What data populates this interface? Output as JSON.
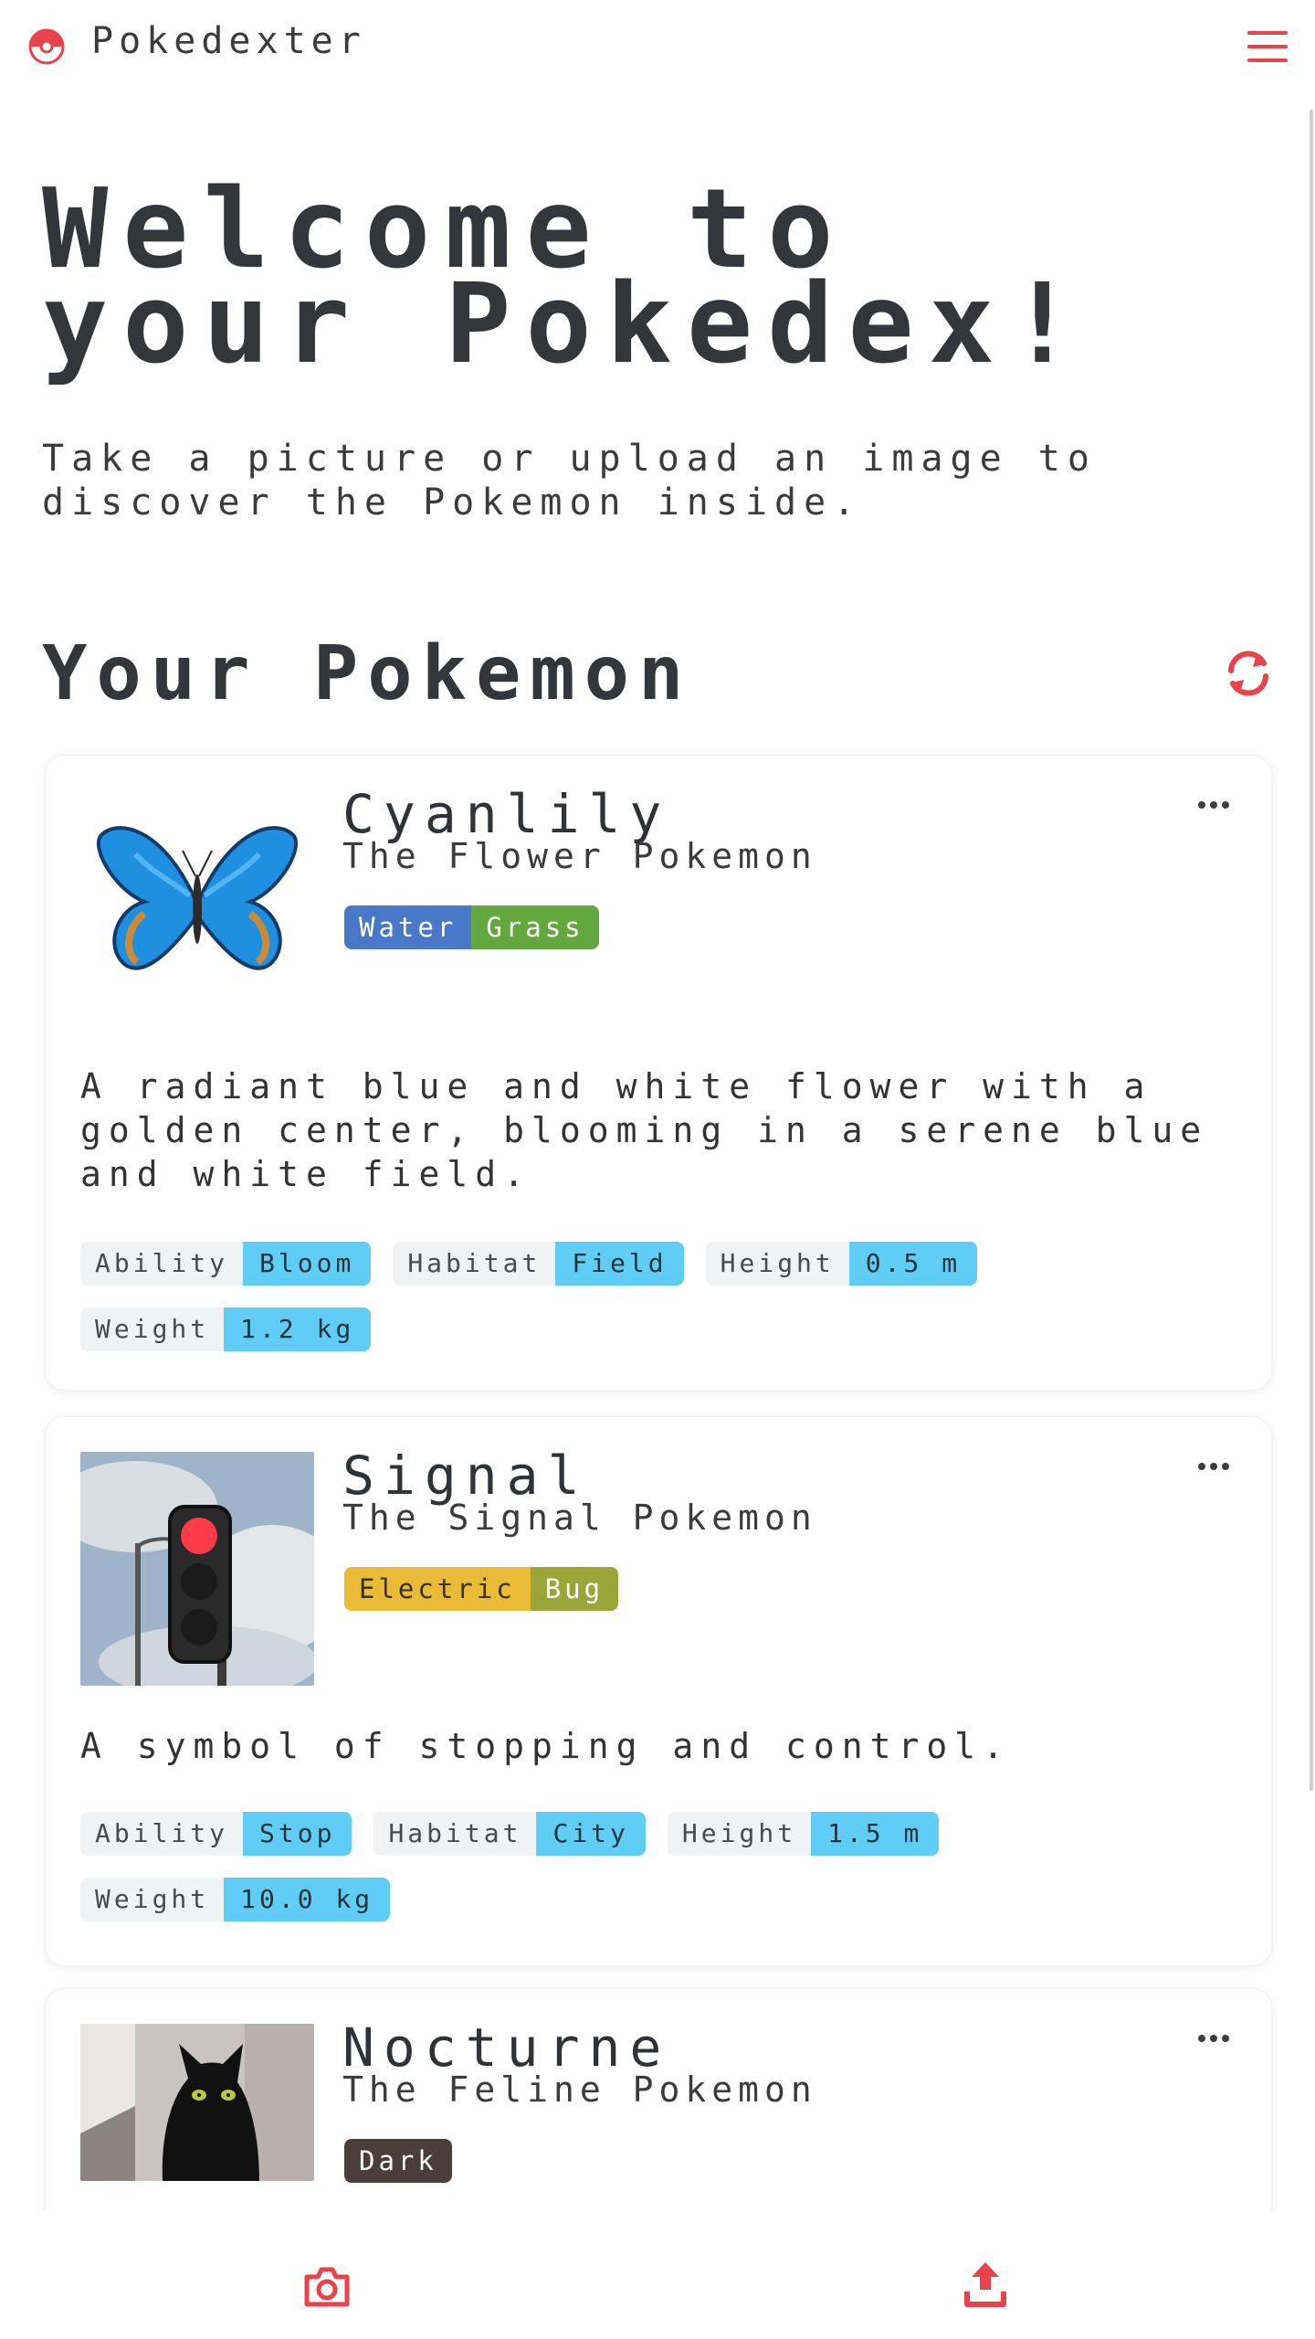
{
  "app": {
    "brand": "Pokedexter"
  },
  "hero": {
    "title_line1": "Welcome to",
    "title_line2": "your Pokedex!",
    "subtitle": "Take a picture or upload an image to discover the Pokemon inside."
  },
  "section": {
    "title": "Your Pokemon"
  },
  "pokemon": [
    {
      "name": "Cyanlily",
      "species": "The Flower Pokemon",
      "types": [
        {
          "label": "Water",
          "color": "#4a78c8"
        },
        {
          "label": "Grass",
          "color": "#62a83f"
        }
      ],
      "description": "A radiant blue and white flower with a golden center, blooming in a serene blue and white field.",
      "stats": [
        {
          "key": "Ability",
          "value": "Bloom"
        },
        {
          "key": "Habitat",
          "value": "Field"
        },
        {
          "key": "Height",
          "value": "0.5 m"
        },
        {
          "key": "Weight",
          "value": "1.2 kg"
        }
      ],
      "image_icon": "butterfly-image"
    },
    {
      "name": "Signal",
      "species": "The Signal Pokemon",
      "types": [
        {
          "label": "Electric",
          "color": "#e9bb37"
        },
        {
          "label": "Bug",
          "color": "#9aa63a"
        }
      ],
      "description": "A symbol of stopping and control.",
      "stats": [
        {
          "key": "Ability",
          "value": "Stop"
        },
        {
          "key": "Habitat",
          "value": "City"
        },
        {
          "key": "Height",
          "value": "1.5 m"
        },
        {
          "key": "Weight",
          "value": "10.0 kg"
        }
      ],
      "image_icon": "traffic-light-image"
    },
    {
      "name": "Nocturne",
      "species": "The Feline Pokemon",
      "types": [
        {
          "label": "Dark",
          "color": "#4b3e3a"
        }
      ],
      "image_icon": "black-cat-image"
    }
  ],
  "colors": {
    "accent": "#e8434a",
    "stat_value": "#5fcdf6"
  },
  "icons": [
    "pokeball-icon",
    "hamburger-icon",
    "refresh-icon",
    "more-icon",
    "camera-icon",
    "upload-icon"
  ]
}
